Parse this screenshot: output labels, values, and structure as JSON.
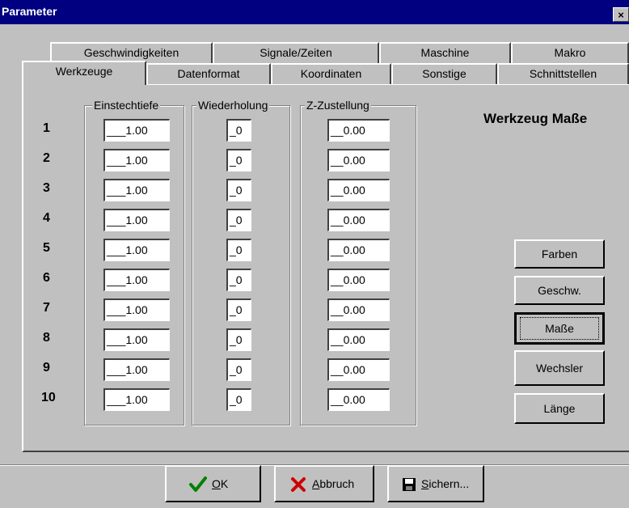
{
  "window": {
    "title": "Parameter",
    "close_glyph": "×"
  },
  "tabs_back": [
    "Geschwindigkeiten",
    "Signale/Zeiten",
    "Maschine",
    "Makro"
  ],
  "tabs_front": [
    "Werkzeuge",
    "Datenformat",
    "Koordinaten",
    "Sonstige",
    "Schnittstellen"
  ],
  "active_tab": "Werkzeuge",
  "groups": {
    "einstechtiefe": "Einstechtiefe",
    "wiederholung": "Wiederholung",
    "zzustellung": "Z-Zustellung"
  },
  "heading": "Werkzeug Maße",
  "rows": [
    {
      "num": "1",
      "einstechtiefe": "___1.00",
      "wiederholung": "_0",
      "zzustellung": "__0.00"
    },
    {
      "num": "2",
      "einstechtiefe": "___1.00",
      "wiederholung": "_0",
      "zzustellung": "__0.00"
    },
    {
      "num": "3",
      "einstechtiefe": "___1.00",
      "wiederholung": "_0",
      "zzustellung": "__0.00"
    },
    {
      "num": "4",
      "einstechtiefe": "___1.00",
      "wiederholung": "_0",
      "zzustellung": "__0.00"
    },
    {
      "num": "5",
      "einstechtiefe": "___1.00",
      "wiederholung": "_0",
      "zzustellung": "__0.00"
    },
    {
      "num": "6",
      "einstechtiefe": "___1.00",
      "wiederholung": "_0",
      "zzustellung": "__0.00"
    },
    {
      "num": "7",
      "einstechtiefe": "___1.00",
      "wiederholung": "_0",
      "zzustellung": "__0.00"
    },
    {
      "num": "8",
      "einstechtiefe": "___1.00",
      "wiederholung": "_0",
      "zzustellung": "__0.00"
    },
    {
      "num": "9",
      "einstechtiefe": "___1.00",
      "wiederholung": "_0",
      "zzustellung": "__0.00"
    },
    {
      "num": "10",
      "einstechtiefe": "___1.00",
      "wiederholung": "_0",
      "zzustellung": "__0.00"
    }
  ],
  "side_buttons": [
    "Farben",
    "Geschw.",
    "Maße",
    "Wechsler",
    "Länge"
  ],
  "focused_side_button": "Maße",
  "bottom_buttons": {
    "ok": {
      "icon": "checkmark-icon",
      "mnemonic": "O",
      "rest": "K",
      "color": "#008000"
    },
    "abbruch": {
      "icon": "cross-icon",
      "mnemonic": "A",
      "rest": "bbruch",
      "color": "#cc0000"
    },
    "sichern": {
      "icon": "floppy-disk-icon",
      "mnemonic": "S",
      "rest": "ichern..."
    }
  }
}
